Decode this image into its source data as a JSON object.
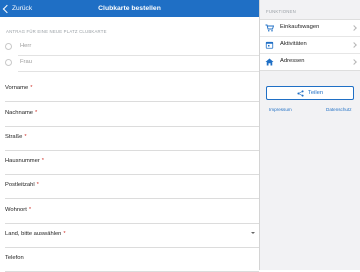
{
  "header": {
    "back_label": "Zurück",
    "title": "Clubkarte bestellen"
  },
  "form": {
    "section_label": "ANTRAG FÜR EINE NEUE PLATZ CLUBKARTE",
    "salutations": [
      "Herr",
      "Frau"
    ],
    "required_marker": "*",
    "fields": [
      {
        "label": "Vorname",
        "required": true
      },
      {
        "label": "Nachname",
        "required": true
      },
      {
        "label": "Straße",
        "required": true
      },
      {
        "label": "Hausnummer",
        "required": true
      },
      {
        "label": "Postleitzahl",
        "required": true
      },
      {
        "label": "Wohnort",
        "required": true
      },
      {
        "label": "Land, bitte auswählen",
        "required": true
      },
      {
        "label": "Telefon",
        "required": false
      }
    ]
  },
  "sidebar": {
    "section_label": "FUNKTIONEN",
    "items": [
      {
        "label": "Einkaufswagen",
        "icon": "cart-icon"
      },
      {
        "label": "Aktivitäten",
        "icon": "calendar-icon"
      },
      {
        "label": "Adressen",
        "icon": "home-icon"
      }
    ],
    "share_label": "Teilen",
    "links": {
      "impressum": "Impressum",
      "datenschutz": "Datenschutz"
    }
  },
  "colors": {
    "accent": "#1f6fc5",
    "required": "#d0342c"
  }
}
